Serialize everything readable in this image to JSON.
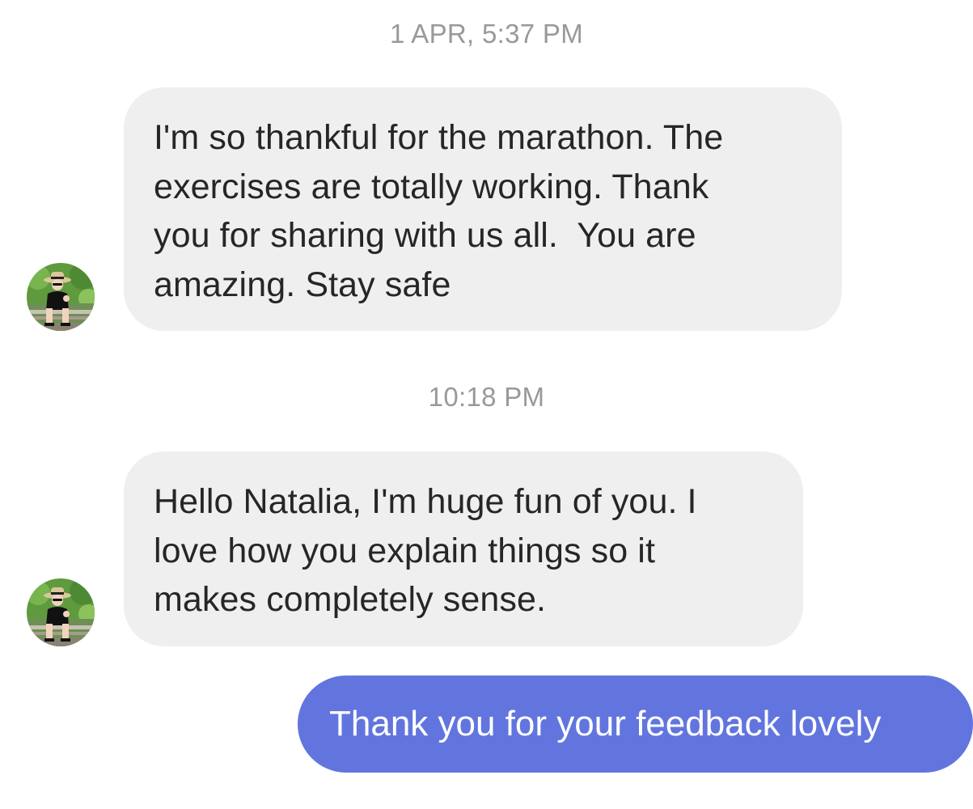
{
  "thread": {
    "groups": [
      {
        "timestamp": "1 APR, 5:37 PM",
        "incoming": {
          "lines": [
            "I'm so thankful for the marathon. The",
            "exercises are totally working. Thank",
            "you for sharing with us all.  You are",
            "amazing. Stay safe"
          ]
        }
      },
      {
        "timestamp": "10:18 PM",
        "incoming": {
          "lines": [
            "Hello Natalia, I'm huge fun of you. I",
            "love how you explain things so it",
            "makes completely sense."
          ]
        },
        "outgoing": {
          "text": "Thank you for your feedback lovely"
        }
      }
    ]
  },
  "colors": {
    "incoming_bubble": "#efefef",
    "outgoing_bubble": "#6275de",
    "timestamp_text": "#999999",
    "message_text": "#262626"
  },
  "icons": {
    "avatar": "sender-avatar-photo"
  }
}
